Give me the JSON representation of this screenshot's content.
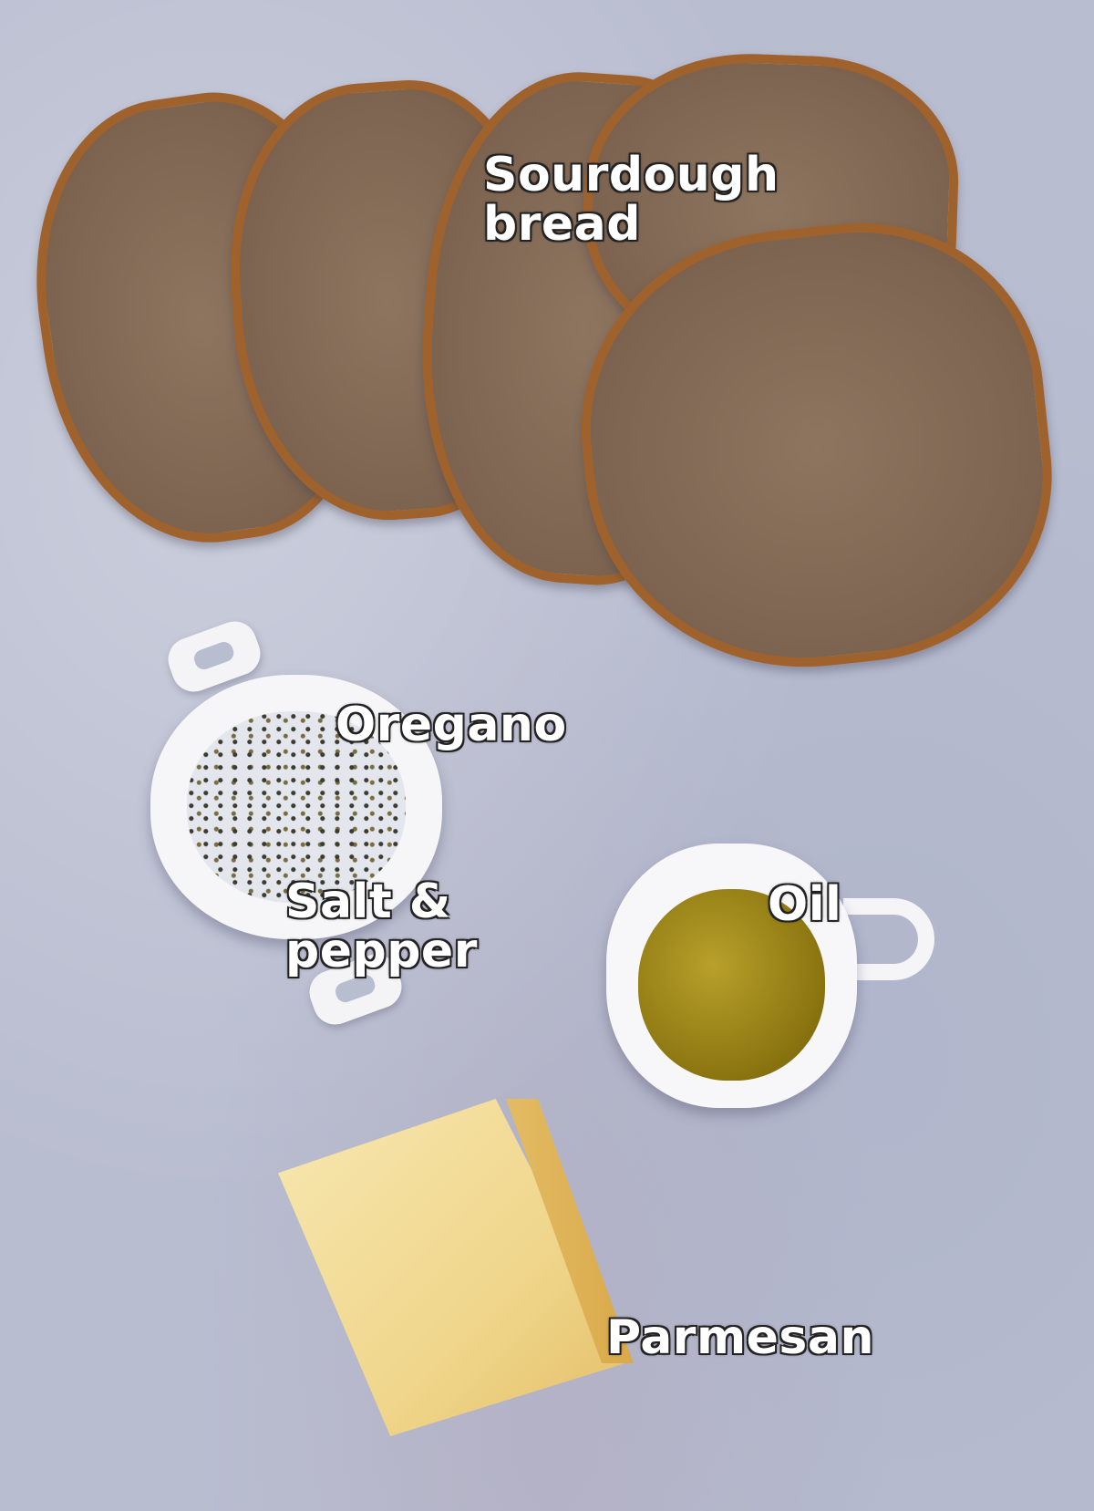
{
  "image": {
    "description": "Overhead photo of bruschetta ingredients on a light blue-grey surface",
    "labels": {
      "sourdough_line1": "Sourdough",
      "sourdough_line2": "bread",
      "oregano": "Oregano",
      "salt_line1": "Salt &",
      "salt_line2": "pepper",
      "oil": "Oil",
      "parmesan": "Parmesan"
    },
    "colors": {
      "background": "#b9bdd0",
      "label_text": "#ffffff",
      "label_outline": "#222222"
    }
  }
}
